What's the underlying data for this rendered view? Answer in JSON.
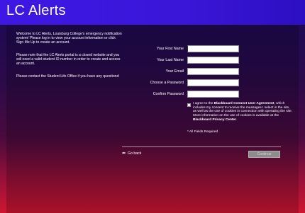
{
  "header": {
    "title": "LC Alerts"
  },
  "info": {
    "paragraph1": "Welcome to LC Alerts, Louisburg College's emergency notification system! Please log in to view your account information or click Sign Me Up to create an account.",
    "paragraph2": "Please note that the LC Alerts portal is a closed website and you will need a valid student ID number in order to create and access an account.",
    "paragraph3": "Please contact the Student Life Office if you have any questions!"
  },
  "form": {
    "first_name_label": "Your First Name",
    "last_name_label": "Your Last Name",
    "email_label": "Your Email",
    "password_label": "Choose a Password",
    "confirm_label": "Confirm Password",
    "first_name_value": "",
    "last_name_value": "",
    "email_value": "",
    "password_value": "",
    "confirm_value": ""
  },
  "agreement": {
    "prefix": "I agree to the ",
    "agreement_link": "Blackboard Connect User Agreement",
    "middle": ", which includes my consent to receive the messages I select in the site, as well as the use of cookies in connection with operating the site. More information on the use of cookies is available at the ",
    "privacy_link": "Blackboard Privacy Center",
    "suffix": ".",
    "checked": false
  },
  "required_note": "* All Fields Required",
  "footer": {
    "go_back_icon": "arrow-left-icon",
    "go_back_label": "Go back",
    "continue_label": "Continue"
  }
}
